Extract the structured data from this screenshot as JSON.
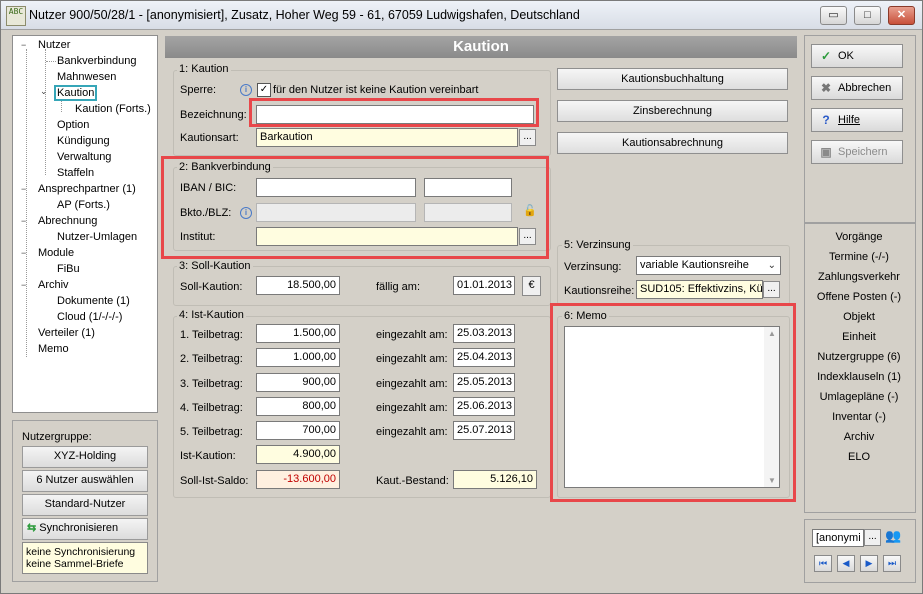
{
  "window": {
    "title": "Nutzer 900/50/28/1 - [anonymisiert], Zusatz, Hoher Weg 59 - 61, 67059 Ludwigshafen, Deutschland",
    "icon_text": "ABC",
    "controls": {
      "minimize": "▭",
      "maximize": "□",
      "close": "✕"
    }
  },
  "tree": {
    "items": [
      {
        "label": "Nutzer",
        "toggle": "−"
      },
      {
        "label": "Bankverbindung"
      },
      {
        "label": "Mahnwesen"
      },
      {
        "label": "Kaution",
        "toggle": "⌄"
      },
      {
        "label": "Kaution (Forts.)"
      },
      {
        "label": "Option"
      },
      {
        "label": "Kündigung"
      },
      {
        "label": "Verwaltung"
      },
      {
        "label": "Staffeln"
      },
      {
        "label": "Ansprechpartner (1)",
        "toggle": "−"
      },
      {
        "label": "AP (Forts.)"
      },
      {
        "label": "Abrechnung",
        "toggle": "−"
      },
      {
        "label": "Nutzer-Umlagen"
      },
      {
        "label": "Module",
        "toggle": "−"
      },
      {
        "label": "FiBu"
      },
      {
        "label": "Archiv",
        "toggle": "−"
      },
      {
        "label": "Dokumente (1)"
      },
      {
        "label": "Cloud (1/-/-/-)"
      },
      {
        "label": "Verteiler (1)"
      },
      {
        "label": "Memo"
      }
    ]
  },
  "nutzergruppe": {
    "label": "Nutzergruppe:",
    "btn1": "XYZ-Holding",
    "btn2": "6 Nutzer auswählen",
    "btn3": "Standard-Nutzer",
    "sync": "Synchronisieren",
    "note1": "keine Synchronisierung",
    "note2": "keine Sammel-Briefe"
  },
  "header": {
    "title": "Kaution"
  },
  "kaution": {
    "group_title": "1: Kaution",
    "sperre_label": "Sperre:",
    "sperre_text": "für den Nutzer ist keine Kaution vereinbart",
    "sperre_check": "✓",
    "bezeichnung_label": "Bezeichnung:",
    "bezeichnung_value": "",
    "kautionsart_label": "Kautionsart:",
    "kautionsart_value": "Barkaution"
  },
  "bank": {
    "group_title": "2: Bankverbindung",
    "iban_label": "IBAN / BIC:",
    "bkto_label": "Bkto./BLZ:",
    "institut_label": "Institut:"
  },
  "soll": {
    "group_title": "3: Soll-Kaution",
    "soll_label": "Soll-Kaution:",
    "soll_value": "18.500,00",
    "faellig_label": "fällig am:",
    "faellig_value": "01.01.2013",
    "currency": "€"
  },
  "ist": {
    "group_title": "4: Ist-Kaution",
    "rows": [
      {
        "label": "1. Teilbetrag:",
        "amount": "1.500,00",
        "paid_label": "eingezahlt am:",
        "date": "25.03.2013"
      },
      {
        "label": "2. Teilbetrag:",
        "amount": "1.000,00",
        "paid_label": "eingezahlt am:",
        "date": "25.04.2013"
      },
      {
        "label": "3. Teilbetrag:",
        "amount": "900,00",
        "paid_label": "eingezahlt am:",
        "date": "25.05.2013"
      },
      {
        "label": "4. Teilbetrag:",
        "amount": "800,00",
        "paid_label": "eingezahlt am:",
        "date": "25.06.2013"
      },
      {
        "label": "5. Teilbetrag:",
        "amount": "700,00",
        "paid_label": "eingezahlt am:",
        "date": "25.07.2013"
      }
    ],
    "ist_label": "Ist-Kaution:",
    "ist_value": "4.900,00",
    "saldo_label": "Soll-Ist-Saldo:",
    "saldo_value": "-13.600,00",
    "bestand_label": "Kaut.-Bestand:",
    "bestand_value": "5.126,10"
  },
  "actions": {
    "buchhaltung": "Kautionsbuchhaltung",
    "zins": "Zinsberechnung",
    "abrechnung": "Kautionsabrechnung"
  },
  "verzinsung": {
    "group_title": "5: Verzinsung",
    "verzinsung_label": "Verzinsung:",
    "verzinsung_value": "variable Kautionsreihe",
    "reihe_label": "Kautionsreihe:",
    "reihe_value": "SUD105: Effektivzins, Kü"
  },
  "memo": {
    "group_title": "6: Memo"
  },
  "right": {
    "ok": "OK",
    "cancel": "Abbrechen",
    "help": "Hilfe",
    "save": "Speichern",
    "links": [
      "Vorgänge",
      "Termine (-/-)",
      "Zahlungsverkehr",
      "Offene Posten (-)",
      "Objekt",
      "Einheit",
      "Nutzergruppe (6)",
      "Indexklauseln (1)",
      "Umlagepläne (-)",
      "Inventar (-)",
      "Archiv",
      "ELO"
    ],
    "search_value": "[anonymi"
  },
  "colors": {
    "highlight": "#e8474a",
    "selection": "#36a6b8"
  }
}
